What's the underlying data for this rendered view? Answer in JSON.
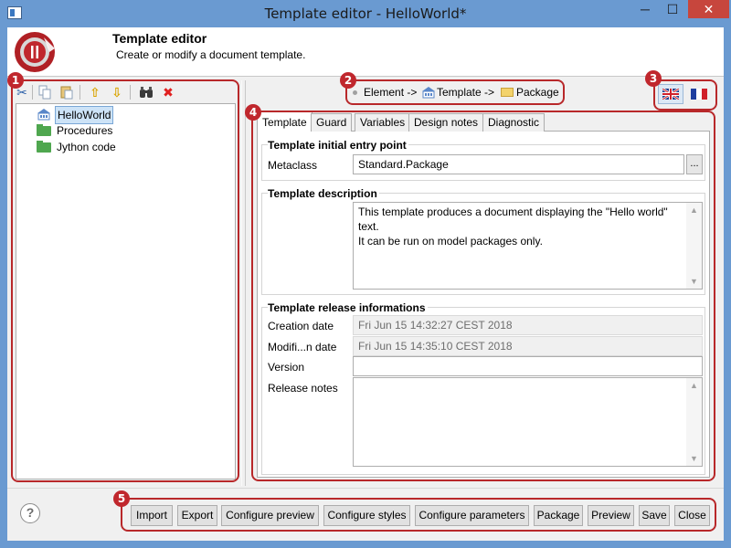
{
  "window": {
    "title": "Template editor - HelloWorld*",
    "minimize_glyph": "─",
    "maximize_glyph": "☐",
    "close_glyph": "✕"
  },
  "header": {
    "title": "Template editor",
    "subtitle": "Create or modify a document template."
  },
  "toolbar": {
    "icons": [
      "scissors-icon",
      "copy-icon",
      "paste-icon",
      "arrow-up-icon",
      "arrow-down-icon",
      "binoculars-icon",
      "delete-icon"
    ],
    "cut_glyph": "✂",
    "up_glyph": "⇧",
    "down_glyph": "⇩",
    "find_glyph": "⌕",
    "delete_glyph": "✖"
  },
  "tree": {
    "items": [
      {
        "label": "HelloWorld",
        "icon": "package-icon",
        "selected": true
      },
      {
        "label": "Procedures",
        "icon": "folder-icon"
      },
      {
        "label": "Jython code",
        "icon": "folder-icon"
      }
    ]
  },
  "breadcrumb": {
    "seg1": "Element ->",
    "seg2": "Template ->",
    "seg3": "Package"
  },
  "badges": [
    "1",
    "2",
    "3",
    "4",
    "5"
  ],
  "languages": [
    {
      "name": "english",
      "icon": "uk-flag-icon",
      "active": true
    },
    {
      "name": "french",
      "icon": "fr-flag-icon",
      "active": false
    }
  ],
  "tabs": [
    {
      "label": "Template",
      "active": true
    },
    {
      "label": "Guard"
    },
    {
      "label": "Variables"
    },
    {
      "label": "Design notes"
    },
    {
      "label": "Diagnostic"
    }
  ],
  "entry_point": {
    "group_title": "Template initial entry point",
    "metaclass_label": "Metaclass",
    "metaclass_value": "Standard.Package",
    "browse_label": "..."
  },
  "description": {
    "group_title": "Template description",
    "text": "This template produces a document displaying the \"Hello world\"\ntext.\nIt can be run on model packages only."
  },
  "release": {
    "group_title": "Template release informations",
    "creation_label": "Creation date",
    "creation_value": "Fri Jun 15 14:32:27 CEST 2018",
    "modified_label": "Modifi...n date",
    "modified_value": "Fri Jun 15 14:35:10 CEST 2018",
    "version_label": "Version",
    "version_value": "",
    "notes_label": "Release notes",
    "notes_value": ""
  },
  "help_glyph": "?",
  "buttons": {
    "import": "Import",
    "export": "Export",
    "configure_preview": "Configure preview",
    "configure_styles": "Configure styles",
    "configure_parameters": "Configure parameters",
    "package": "Package",
    "preview": "Preview",
    "save": "Save",
    "close": "Close"
  },
  "colors": {
    "frame": "#6a9ad1",
    "annotation_red": "#b8282a",
    "close_button": "#c7463d",
    "selection": "#cde3f7",
    "folder_green": "#4fa74f"
  }
}
